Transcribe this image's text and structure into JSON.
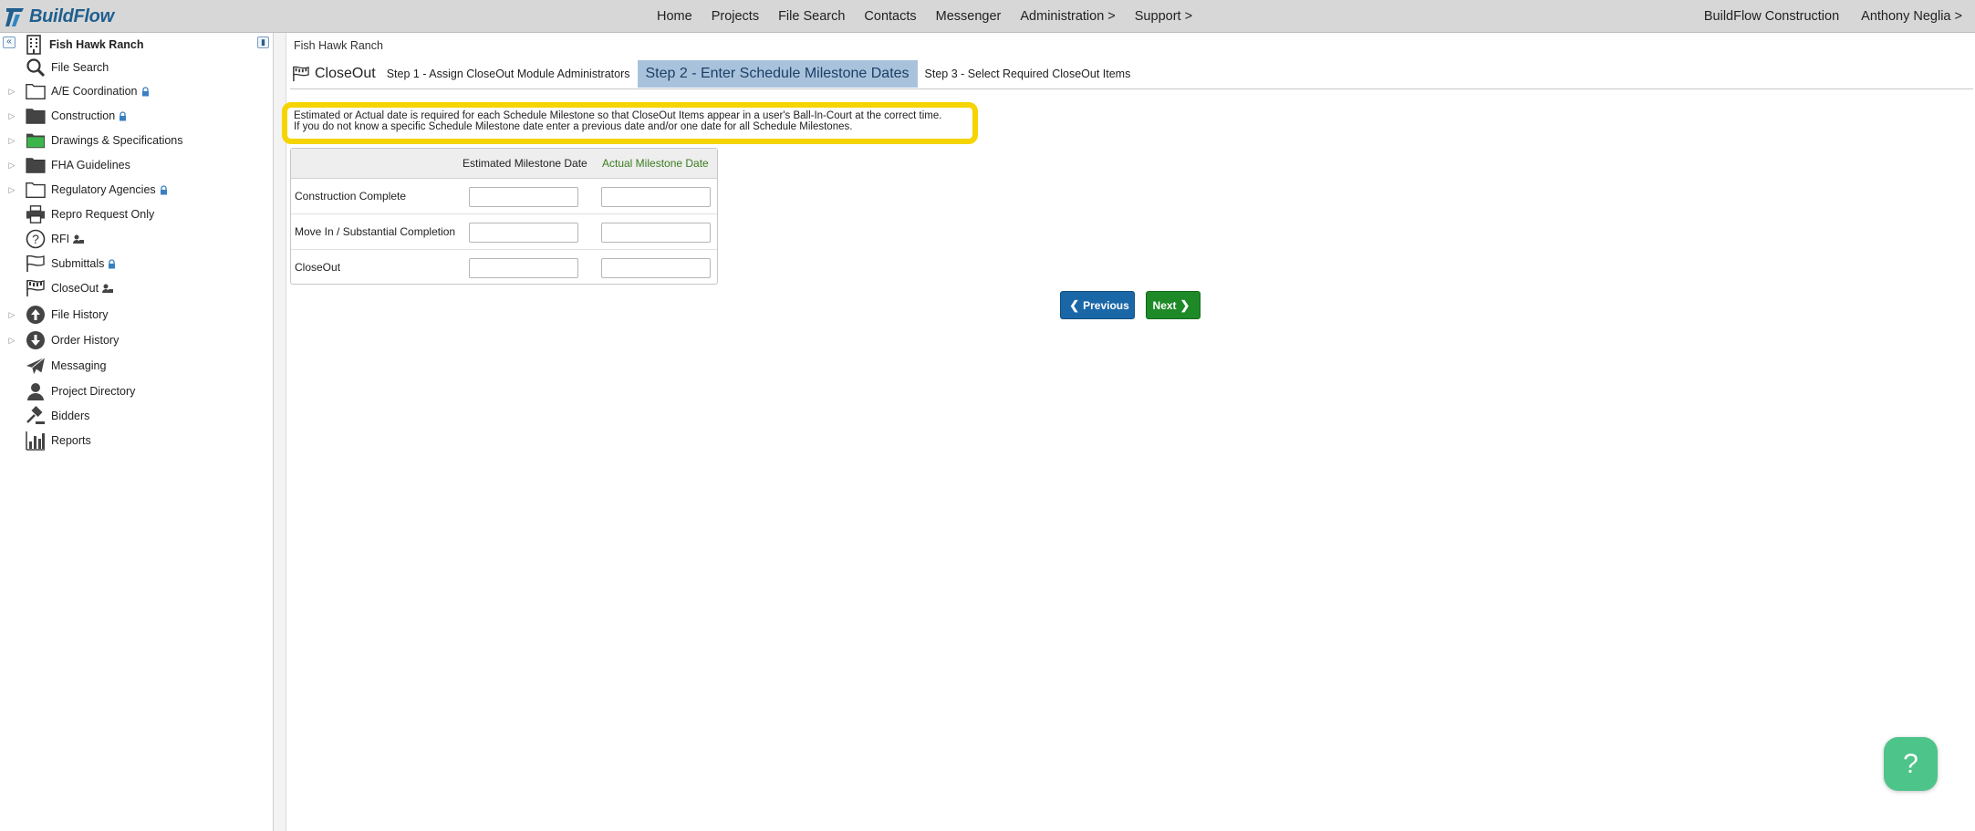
{
  "brand": {
    "name": "BuildFlow",
    "color": "#1f5f8f"
  },
  "topnav": {
    "items": [
      "Home",
      "Projects",
      "File Search",
      "Contacts",
      "Messenger",
      "Administration >",
      "Support >"
    ],
    "company": "BuildFlow Construction",
    "user": "Anthony Neglia >"
  },
  "sidebar": {
    "project": "Fish Hawk Ranch",
    "items": [
      {
        "label": "File Search",
        "icon": "magnifier-icon"
      },
      {
        "label": "A/E Coordination",
        "icon": "folder-outline-icon"
      },
      {
        "label": "Construction",
        "icon": "folder-dark-icon"
      },
      {
        "label": "Drawings & Specifications",
        "icon": "folder-green-icon"
      },
      {
        "label": "FHA Guidelines",
        "icon": "folder-dark-icon"
      },
      {
        "label": "Regulatory Agencies",
        "icon": "folder-outline-icon"
      },
      {
        "label": "Repro Request Only",
        "icon": "printer-icon"
      },
      {
        "label": "RFI",
        "icon": "question-circle-icon"
      },
      {
        "label": "Submittals",
        "icon": "flag-icon"
      },
      {
        "label": "CloseOut",
        "icon": "checkered-flag-icon"
      },
      {
        "label": "File History",
        "icon": "upload-circle-icon"
      },
      {
        "label": "Order History",
        "icon": "download-circle-icon"
      },
      {
        "label": "Messaging",
        "icon": "paper-plane-icon"
      },
      {
        "label": "Project Directory",
        "icon": "person-icon"
      },
      {
        "label": "Bidders",
        "icon": "gavel-icon"
      },
      {
        "label": "Reports",
        "icon": "bar-chart-icon"
      }
    ]
  },
  "main": {
    "breadcrumb": "Fish Hawk Ranch",
    "module_title": "CloseOut",
    "steps": [
      "Step 1 - Assign CloseOut Module Administrators",
      "Step 2 - Enter Schedule Milestone Dates",
      "Step 3 - Select Required CloseOut Items"
    ],
    "notice": {
      "line1": "Estimated or Actual date is required for each Schedule Milestone so that CloseOut Items appear in a user's Ball-In-Court at the correct time.",
      "line2": "If you do not know a specific Schedule Milestone date enter a previous date and/or one date for all Schedule Milestones.",
      "highlight_color": "#f5d400"
    },
    "table": {
      "col_estimated": "Estimated Milestone Date",
      "col_actual": "Actual Milestone Date",
      "rows": [
        {
          "label": "Construction Complete",
          "estimated": "",
          "actual": ""
        },
        {
          "label": "Move In / Substantial Completion",
          "estimated": "",
          "actual": ""
        },
        {
          "label": "CloseOut",
          "estimated": "",
          "actual": ""
        }
      ]
    },
    "buttons": {
      "previous": "Previous",
      "next": "Next"
    },
    "help": "?"
  }
}
